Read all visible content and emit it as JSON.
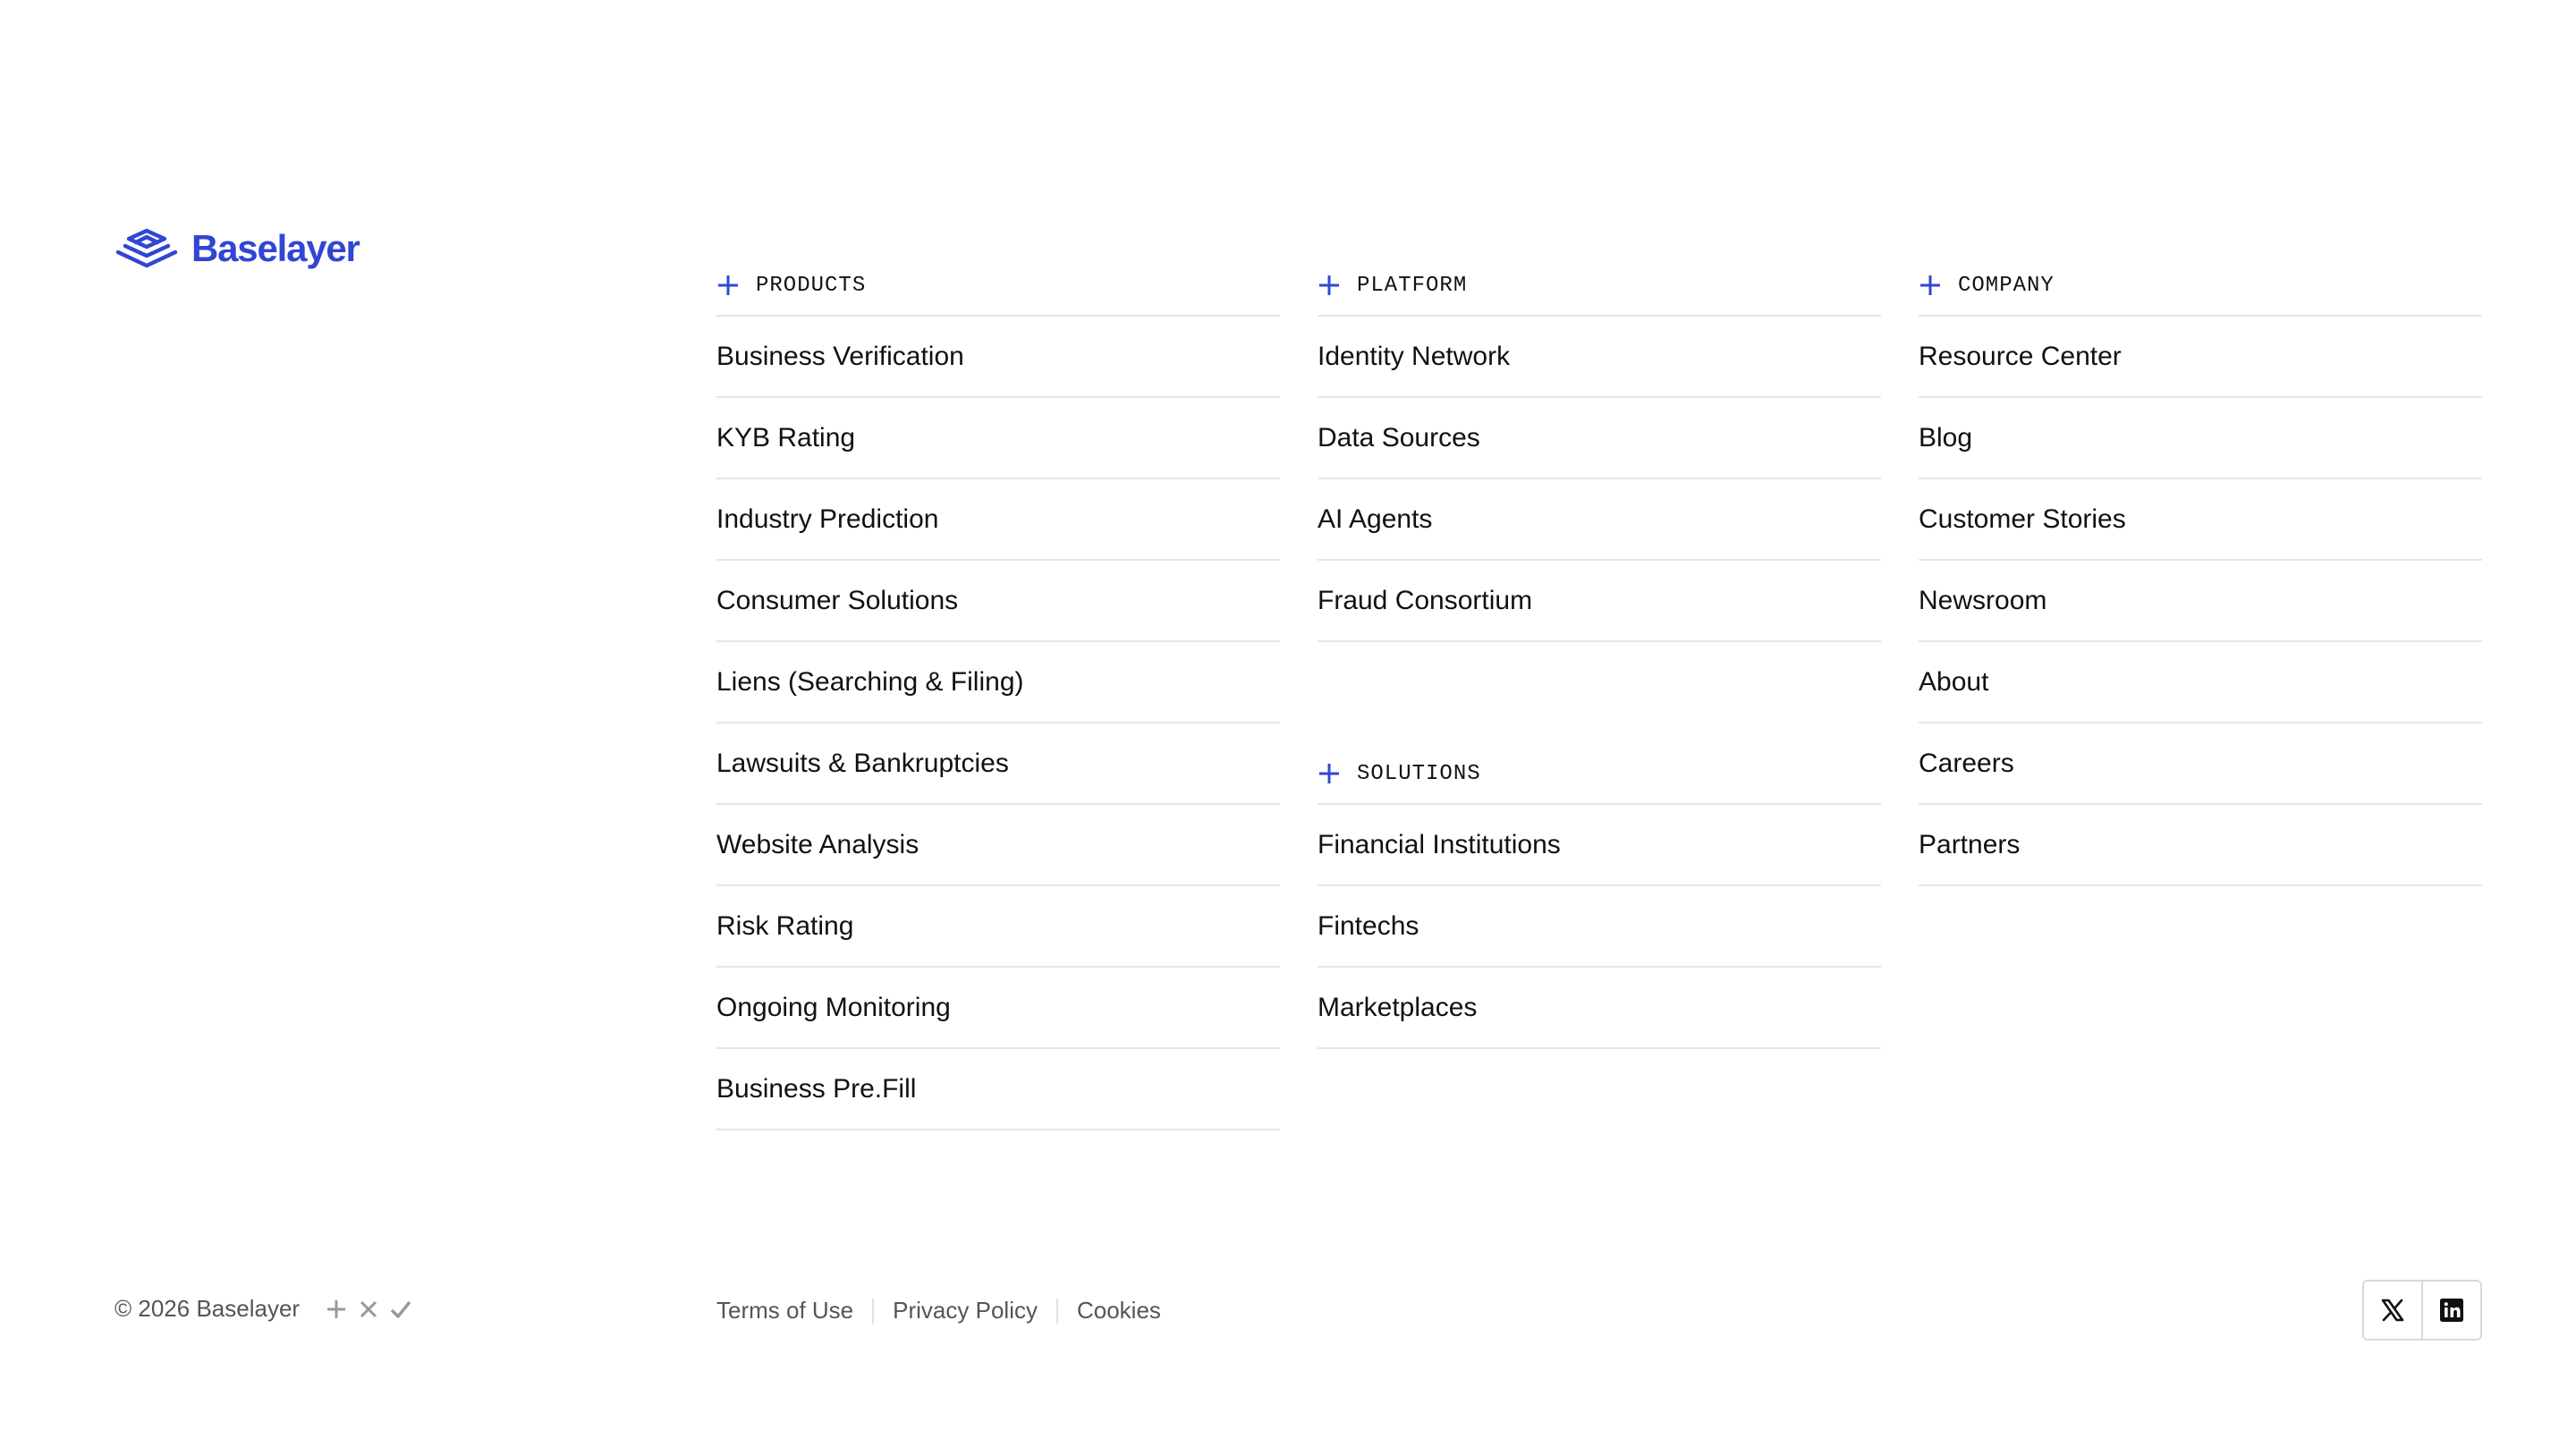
{
  "brand": {
    "name": "Baselayer",
    "accent_color": "#3046d4",
    "logo_icon": "stacked-layers-icon"
  },
  "products": {
    "heading": "PRODUCTS",
    "items": [
      "Business Verification",
      "KYB Rating",
      "Industry Prediction",
      "Consumer Solutions",
      "Liens (Searching & Filing)",
      "Lawsuits & Bankruptcies",
      "Website Analysis",
      "Risk Rating",
      "Ongoing Monitoring",
      "Business Pre.Fill"
    ]
  },
  "platform": {
    "heading": "PLATFORM",
    "items": [
      "Identity Network",
      "Data Sources",
      "AI Agents",
      "Fraud Consortium"
    ]
  },
  "solutions": {
    "heading": "SOLUTIONS",
    "items": [
      "Financial Institutions",
      "Fintechs",
      "Marketplaces"
    ]
  },
  "company": {
    "heading": "COMPANY",
    "items": [
      "Resource Center",
      "Blog",
      "Customer Stories",
      "Newsroom",
      "About",
      "Careers",
      "Partners"
    ]
  },
  "footer": {
    "copyright": "© 2026 Baselayer",
    "mark_icons": [
      "plus-icon",
      "x-icon",
      "check-icon"
    ],
    "legal_links": [
      "Terms of Use",
      "Privacy Policy",
      "Cookies"
    ],
    "social": [
      "x-twitter-icon",
      "linkedin-icon"
    ]
  }
}
